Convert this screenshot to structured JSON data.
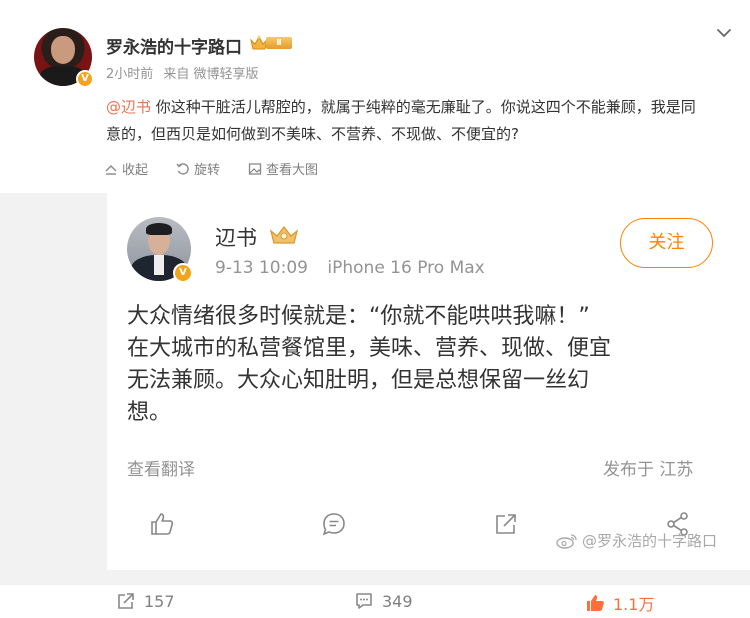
{
  "post": {
    "author": "罗永浩的十字路口",
    "avatar_badge": "V",
    "level_badge": "Ⅱ",
    "time": "2小时前",
    "source": "来自 微博轻享版",
    "mention": "@辺书",
    "text": " 你这种干脏活儿帮腔的，就属于纯粹的毫无廉耻了。你说这四个不能兼顾，我是同意的，但西贝是如何做到不美味、不营养、不现做、不便宜的?",
    "actions": {
      "favorite": "收起",
      "rotate": "旋转",
      "view_large": "查看大图"
    }
  },
  "repost": {
    "author": "辺书",
    "avatar_badge": "V",
    "date": "9-13 10:09",
    "device": "iPhone 16 Pro Max",
    "follow_label": "关注",
    "lines": [
      "大众情绪很多时候就是：“你就不能哄哄我嘛！”",
      "在大城市的私营餐馆里，美味、营养、现做、便宜",
      "无法兼顾。大众心知肚明，但是总想保留一丝幻",
      "想。"
    ],
    "translate": "查看翻译",
    "location": "发布于 江苏"
  },
  "watermark": "@罗永浩的十字路口",
  "bottom": {
    "repost_count": "157",
    "comment_count": "349",
    "like_count": "1.1万"
  },
  "colors": {
    "accent": "#ff8200",
    "mention": "#eb7350",
    "liked": "#ff6f3c",
    "meta": "#939393"
  },
  "icons": {
    "more": "chevron-down-icon",
    "favorite": "collapse-icon",
    "rotate": "rotate-icon",
    "view_large": "image-icon",
    "like": "thumbs-up-icon",
    "comment": "comment-icon",
    "repost": "repost-icon",
    "share": "share-icon"
  }
}
